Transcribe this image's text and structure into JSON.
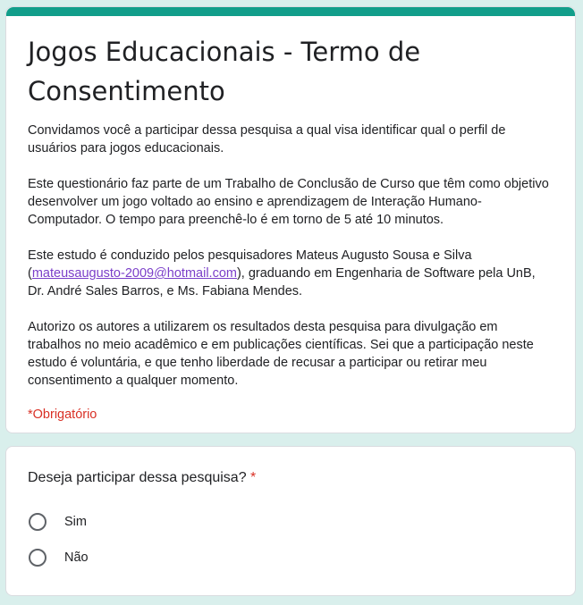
{
  "colors": {
    "accent": "#129e8a",
    "background": "#d9efec",
    "required": "#d93025",
    "link": "#7b3fc9"
  },
  "form": {
    "title": "Jogos Educacionais - Termo de Consentimento",
    "description": {
      "p1": "Convidamos você a participar dessa pesquisa a qual visa identificar qual o perfil de usuários para jogos educacionais.",
      "p2": "Este questionário faz parte de um Trabalho de Conclusão de Curso que têm como objetivo desenvolver um jogo voltado ao ensino e aprendizagem de Interação Humano-Computador. O tempo para preenchê-lo é em torno de 5 até 10 minutos.",
      "p3_before": "Este estudo é conduzido pelos pesquisadores Mateus Augusto Sousa e Silva (",
      "p3_email": "mateusaugusto-2009@hotmail.com",
      "p3_after": "), graduando em Engenharia de Software pela UnB,  Dr. André Sales Barros,  e Ms. Fabiana Mendes.",
      "p4": "Autorizo os autores a utilizarem os resultados desta pesquisa para divulgação em trabalhos no meio acadêmico e em publicações científicas. Sei que a participação neste estudo é voluntária, e que tenho liberdade de recusar a participar ou retirar meu consentimento a qualquer momento."
    },
    "required_note": "*Obrigatório"
  },
  "question": {
    "title": "Deseja participar dessa pesquisa?",
    "required_mark": "*",
    "options": [
      {
        "label": "Sim",
        "selected": false
      },
      {
        "label": "Não",
        "selected": false
      }
    ]
  }
}
